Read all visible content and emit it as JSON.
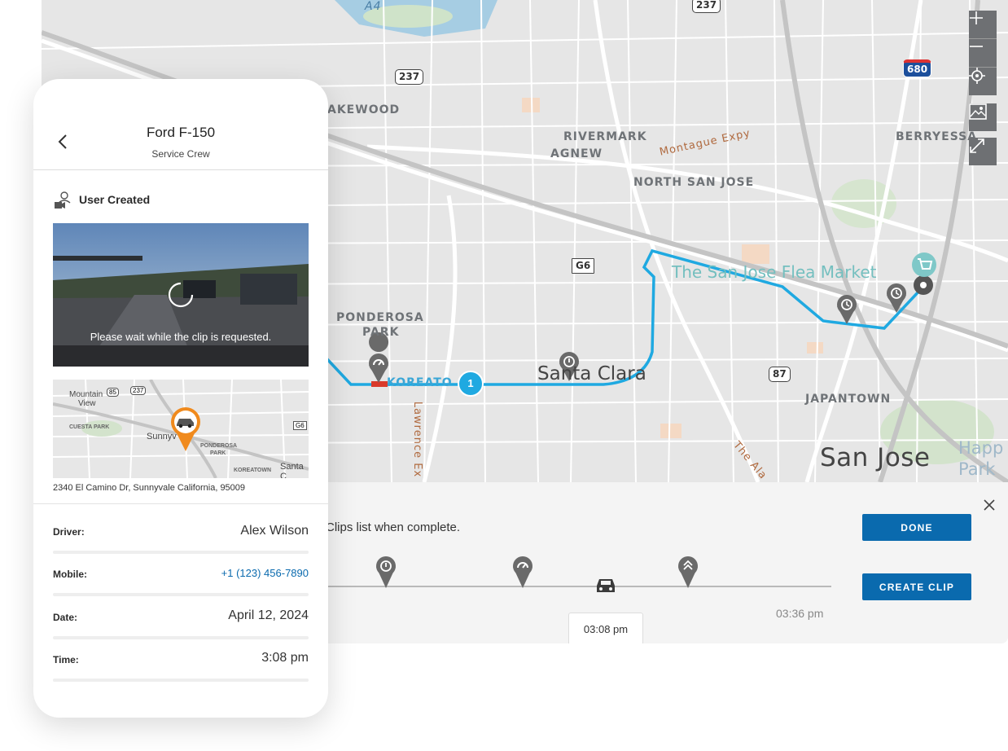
{
  "map": {
    "labels": {
      "lakewood": "AKEWOOD",
      "rivermark": "RIVERMARK",
      "agnew": "AGNEW",
      "montague": "Montague Expy",
      "north_san_jose": "NORTH SAN JOSE",
      "berryessa": "BERRYESSA",
      "flea_market": "The San Jose Flea Market",
      "ponderosa": "PONDEROSA",
      "park": "PARK",
      "koreatown": "KOREATO",
      "santa_clara": "Santa Clara",
      "lawrence": "Lawrence Ex",
      "japantown": "JAPANTOWN",
      "san_jose": "San Jose",
      "happy": "Happ",
      "happy2": "Park",
      "the_alameda": "The Ala",
      "a4": "A4"
    },
    "shields": {
      "r237_top": "237",
      "r237": "237",
      "r680": "680",
      "g6": "G6",
      "r87": "87"
    },
    "route_badge": "1",
    "controls": [
      "zoom-in-icon",
      "zoom-out-icon",
      "locate-icon",
      "map-layer-icon",
      "expand-icon"
    ]
  },
  "bottom_panel": {
    "message": "Clips list when complete.",
    "done_label": "DONE",
    "create_clip_label": "CREATE CLIP",
    "current_time": "03:08 pm",
    "end_time": "03:36 pm"
  },
  "phone": {
    "title": "Ford F-150",
    "subtitle": "Service Crew",
    "section_label": "User Created",
    "video_message": "Please wait while the clip is requested.",
    "mini_map": {
      "mountain_view_1": "Mountain",
      "mountain_view_2": "View",
      "cuesta_park": "CUESTA PARK",
      "sunnyvale": "Sunnyv",
      "ponderosa_1": "PONDEROSA",
      "ponderosa_2": "PARK",
      "koreatown": "KOREATOWN",
      "santa_clara": "Santa C",
      "shield_85": "85",
      "shield_237": "237",
      "shield_g6": "G6"
    },
    "address": "2340 El Camino Dr, Sunnyvale California, 95009",
    "details": [
      {
        "label": "Driver:",
        "value": "Alex Wilson"
      },
      {
        "label": "Mobile:",
        "value": "+1 (123) 456-7890"
      },
      {
        "label": "Date:",
        "value": "April 12, 2024"
      },
      {
        "label": "Time:",
        "value": "3:08 pm"
      }
    ]
  },
  "colors": {
    "route": "#1fa9e1",
    "button": "#0a6aae",
    "marker_orange": "#f08a1d",
    "link": "#0a6aae"
  }
}
